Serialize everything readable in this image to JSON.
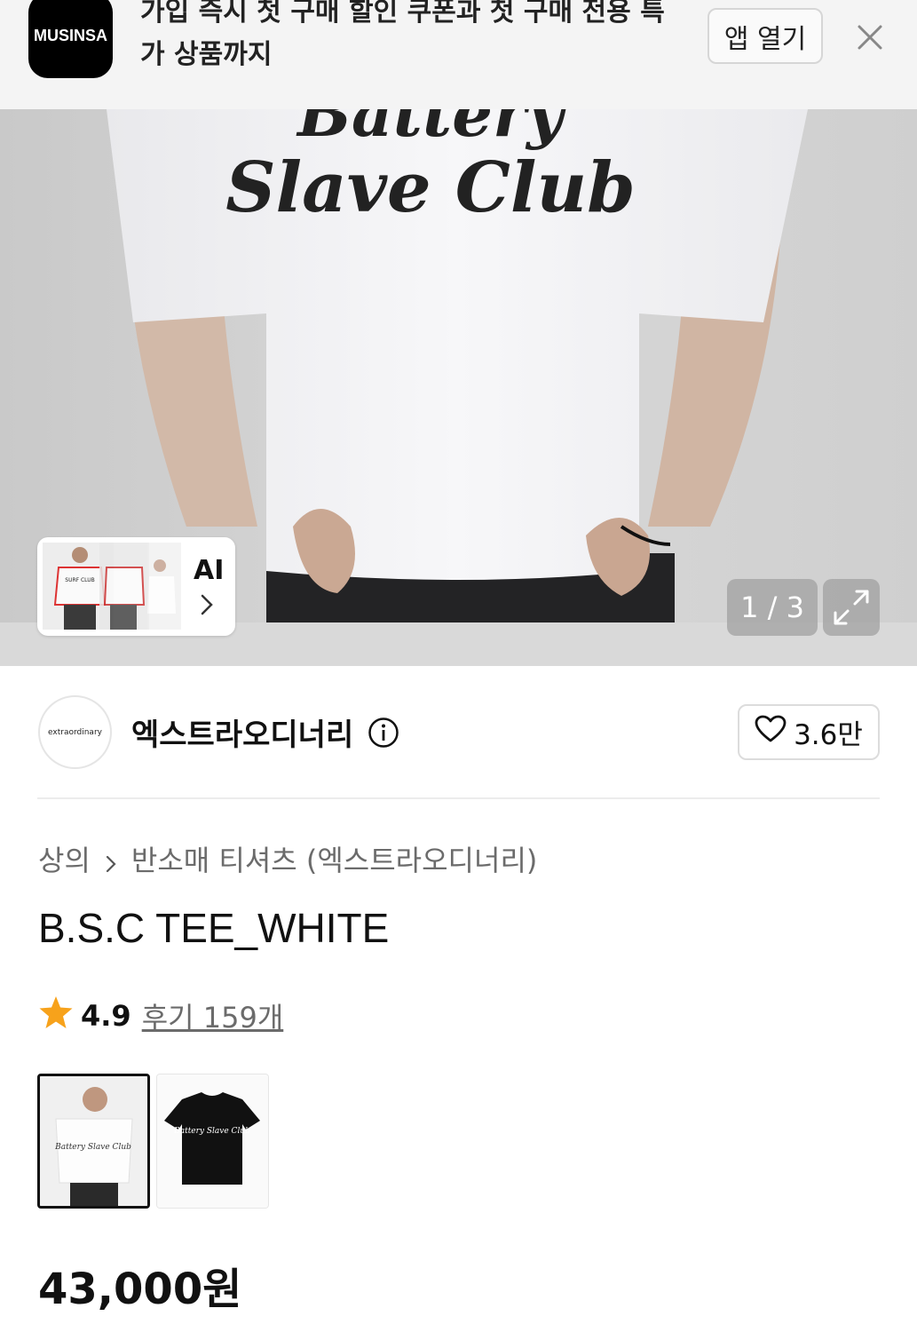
{
  "banner": {
    "logo_text": "MUSINSA",
    "message": "가입 즉시 첫 구매 할인 쿠폰과 첫 구매 전용 특가 상품까지",
    "open_app_label": "앱 열기"
  },
  "hero": {
    "shirt_print_line1": "Battery",
    "shirt_print_line2": "Slave Club",
    "thumb_print": "SURF CLUB",
    "ai_label": "AI",
    "image_counter": "1 / 3"
  },
  "brand": {
    "logo_text": "extraordinary",
    "name": "엑스트라오디너리",
    "likes": "3.6만"
  },
  "product": {
    "breadcrumb": [
      "상의",
      "반소매 티셔츠 (엑스트라오디너리)"
    ],
    "title": "B.S.C TEE_WHITE",
    "rating": "4.9",
    "reviews_label": "후기 159개",
    "variant_prints": [
      "Battery Slave Club",
      "Battery Slave Club"
    ],
    "price": "43,000원"
  },
  "colors": {
    "star": "#f7a21b",
    "text": "#111111",
    "muted": "#6b6b6b"
  }
}
